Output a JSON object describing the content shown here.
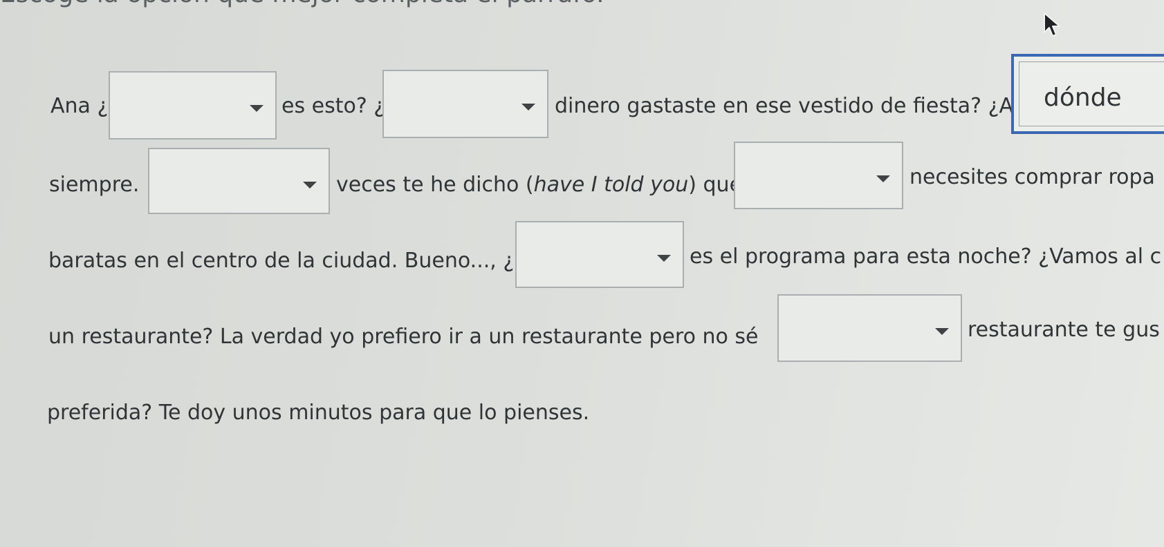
{
  "instruction": "Escoge la opción que mejor completa el párrafo.",
  "paragraph": {
    "t1": "Ana ¿",
    "t2": "es esto? ¿",
    "t3": "dinero gastaste en ese vestido de fiesta? ¿A",
    "t4": "siempre.",
    "t5a": "veces te he dicho (",
    "t5b": "have I told you",
    "t5c": ") que",
    "t6": "necesites comprar ropa",
    "t7": "baratas en el centro de la ciudad. Bueno..., ¿",
    "t8": "es el programa para esta noche? ¿Vamos al c",
    "t9": "un restaurante? La verdad yo prefiero ir a un restaurante pero no sé",
    "t10": "restaurante te gus",
    "t11": "preferida? Te doy unos minutos para que lo pienses."
  },
  "dropdowns": {
    "d1": "",
    "d2": "",
    "d3": "dónde",
    "d4": "",
    "d5": "",
    "d6": "",
    "d7": ""
  },
  "icons": {
    "dropdown_caret": "caret-down-icon",
    "cursor": "mouse-pointer-icon"
  },
  "colors": {
    "focus_border": "#3c67b2",
    "text": "#2f3436",
    "box_border": "#a9aeb0"
  }
}
